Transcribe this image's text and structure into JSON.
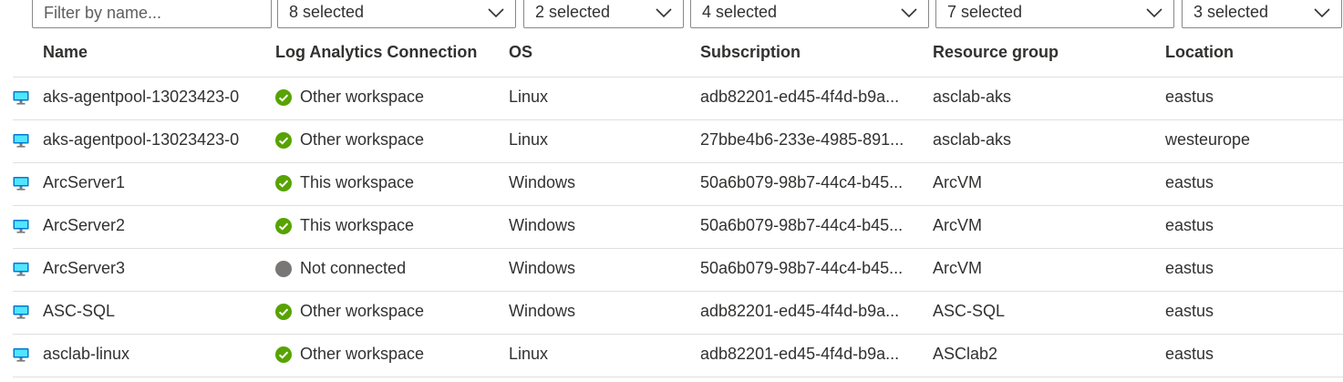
{
  "filters": {
    "name_placeholder": "Filter by name...",
    "name_value": "",
    "dropdowns": [
      {
        "label": "8 selected"
      },
      {
        "label": "2 selected"
      },
      {
        "label": "4 selected"
      },
      {
        "label": "7 selected"
      },
      {
        "label": "3 selected"
      }
    ]
  },
  "columns": {
    "name": "Name",
    "connection": "Log Analytics Connection",
    "os": "OS",
    "subscription": "Subscription",
    "resource_group": "Resource group",
    "location": "Location"
  },
  "colors": {
    "connected": "#57a300",
    "not_connected": "#797775",
    "vm_icon": "#0078d4"
  },
  "rows": [
    {
      "icon": "virtual-machine-icon",
      "name": "aks-agentpool-13023423-0",
      "status": "connected",
      "connection": "Other workspace",
      "os": "Linux",
      "subscription": "adb82201-ed45-4f4d-b9a...",
      "resource_group": "asclab-aks",
      "location": "eastus"
    },
    {
      "icon": "virtual-machine-icon",
      "name": "aks-agentpool-13023423-0",
      "status": "connected",
      "connection": "Other workspace",
      "os": "Linux",
      "subscription": "27bbe4b6-233e-4985-891...",
      "resource_group": "asclab-aks",
      "location": "westeurope"
    },
    {
      "icon": "virtual-machine-icon",
      "name": "ArcServer1",
      "status": "connected",
      "connection": "This workspace",
      "os": "Windows",
      "subscription": "50a6b079-98b7-44c4-b45...",
      "resource_group": "ArcVM",
      "location": "eastus"
    },
    {
      "icon": "virtual-machine-icon",
      "name": "ArcServer2",
      "status": "connected",
      "connection": "This workspace",
      "os": "Windows",
      "subscription": "50a6b079-98b7-44c4-b45...",
      "resource_group": "ArcVM",
      "location": "eastus"
    },
    {
      "icon": "virtual-machine-icon",
      "name": "ArcServer3",
      "status": "not_connected",
      "connection": "Not connected",
      "os": "Windows",
      "subscription": "50a6b079-98b7-44c4-b45...",
      "resource_group": "ArcVM",
      "location": "eastus"
    },
    {
      "icon": "virtual-machine-icon",
      "name": "ASC-SQL",
      "status": "connected",
      "connection": "Other workspace",
      "os": "Windows",
      "subscription": "adb82201-ed45-4f4d-b9a...",
      "resource_group": "ASC-SQL",
      "location": "eastus"
    },
    {
      "icon": "virtual-machine-icon",
      "name": "asclab-linux",
      "status": "connected",
      "connection": "Other workspace",
      "os": "Linux",
      "subscription": "adb82201-ed45-4f4d-b9a...",
      "resource_group": "ASClab2",
      "location": "eastus"
    }
  ]
}
